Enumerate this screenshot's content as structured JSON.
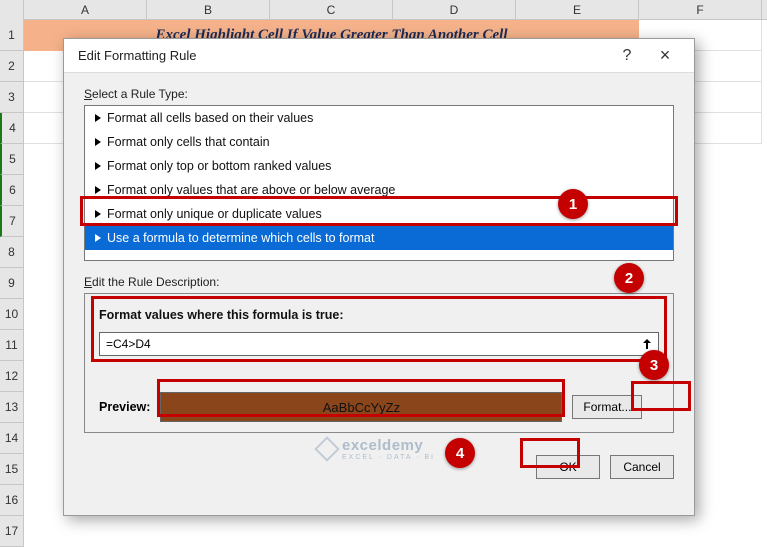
{
  "spreadsheet": {
    "columns": [
      "A",
      "B",
      "C",
      "D",
      "E",
      "F"
    ],
    "rows": [
      "1",
      "2",
      "3",
      "4",
      "5",
      "6",
      "7",
      "8",
      "9",
      "10",
      "11",
      "12",
      "13",
      "14",
      "15",
      "16",
      "17"
    ],
    "merged_title": "Excel Highlight Cell If Value Greater Than Another Cell"
  },
  "dialog": {
    "title": "Edit Formatting Rule",
    "help": "?",
    "close": "×",
    "select_label_pre": "S",
    "select_label_rest": "elect a Rule Type:",
    "rule_types": [
      "Format all cells based on their values",
      "Format only cells that contain",
      "Format only top or bottom ranked values",
      "Format only values that are above or below average",
      "Format only unique or duplicate values",
      "Use a formula to determine which cells to format"
    ],
    "edit_desc_label_pre": "E",
    "edit_desc_label_rest": "dit the Rule Description:",
    "formula_label": "Format values where this formula is true:",
    "formula_value": "=C4>D4",
    "preview_label": "Preview:",
    "preview_text": "AaBbCcYyZz",
    "format_btn": "Format...",
    "ok": "OK",
    "cancel": "Cancel"
  },
  "badges": {
    "b1": "1",
    "b2": "2",
    "b3": "3",
    "b4": "4"
  },
  "watermark": {
    "main": "exceldemy",
    "sub": "EXCEL · DATA · BI"
  }
}
